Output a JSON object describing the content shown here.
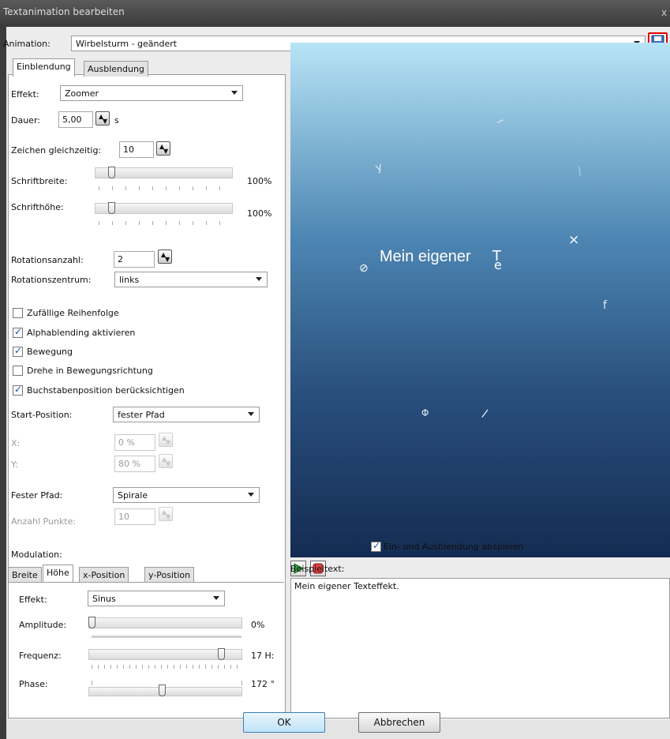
{
  "window_title": "Textanimation bearbeiten",
  "close_glyph": "x",
  "animation": {
    "label": "Animation:",
    "value": "Wirbelsturm - geändert",
    "save_icon": "save-icon"
  },
  "tabs": [
    "Einblendung",
    "Ausblendung"
  ],
  "effekt": {
    "label": "Effekt:",
    "value": "Zoomer"
  },
  "dauer": {
    "label": "Dauer:",
    "value": "5,00",
    "unit": "s"
  },
  "zeichen": {
    "label": "Zeichen gleichzeitig:",
    "value": "10"
  },
  "schriftbreite": {
    "label": "Schriftbreite:",
    "value": "100%"
  },
  "schrifthoehe": {
    "label": "Schrifthöhe:",
    "value": "100%"
  },
  "rotationsanzahl": {
    "label": "Rotationsanzahl:",
    "value": "2"
  },
  "rotationszentrum": {
    "label": "Rotationszentrum:",
    "value": "links"
  },
  "checkboxes": [
    {
      "label": "Zufällige Reihenfolge",
      "checked": false
    },
    {
      "label": "Alphablending aktivieren",
      "checked": true
    },
    {
      "label": "Bewegung",
      "checked": true
    },
    {
      "label": "Drehe in Bewegungsrichtung",
      "checked": false
    },
    {
      "label": "Buchstabenposition berücksichtigen",
      "checked": true
    }
  ],
  "start_position": {
    "label": "Start-Position:",
    "value": "fester Pfad"
  },
  "x": {
    "label": "X:",
    "value": "0 %"
  },
  "y": {
    "label": "Y:",
    "value": "80 %"
  },
  "fester_pfad": {
    "label": "Fester Pfad:",
    "value": "Spirale"
  },
  "anzahl_punkte": {
    "label": "Anzahl Punkte:",
    "value": "10"
  },
  "modulation": {
    "label": "Modulation:",
    "tabs": [
      "Breite",
      "Höhe",
      "x-Position",
      "y-Position"
    ],
    "effekt": {
      "label": "Effekt:",
      "value": "Sinus"
    },
    "amplitude": {
      "label": "Amplitude:",
      "value": "0%"
    },
    "frequenz": {
      "label": "Frequenz:",
      "value": "17 H:"
    },
    "phase": {
      "label": "Phase:",
      "value": "172 °"
    }
  },
  "preview": {
    "text": "Mein eigener",
    "glyphs": [
      "y",
      "−",
      "\\",
      "×",
      "⊘",
      "f",
      "Φ",
      "/",
      "T",
      "e"
    ]
  },
  "playback": {
    "play_icon": "play-icon",
    "stop_icon": "stop-icon",
    "checkbox_label": "Ein- und Ausblendung abspielen",
    "checked": true
  },
  "beispieltext": {
    "label": "Beispieltext:",
    "value": "Mein eigener Texteffekt."
  },
  "buttons": {
    "ok": "OK",
    "cancel": "Abbrechen"
  }
}
